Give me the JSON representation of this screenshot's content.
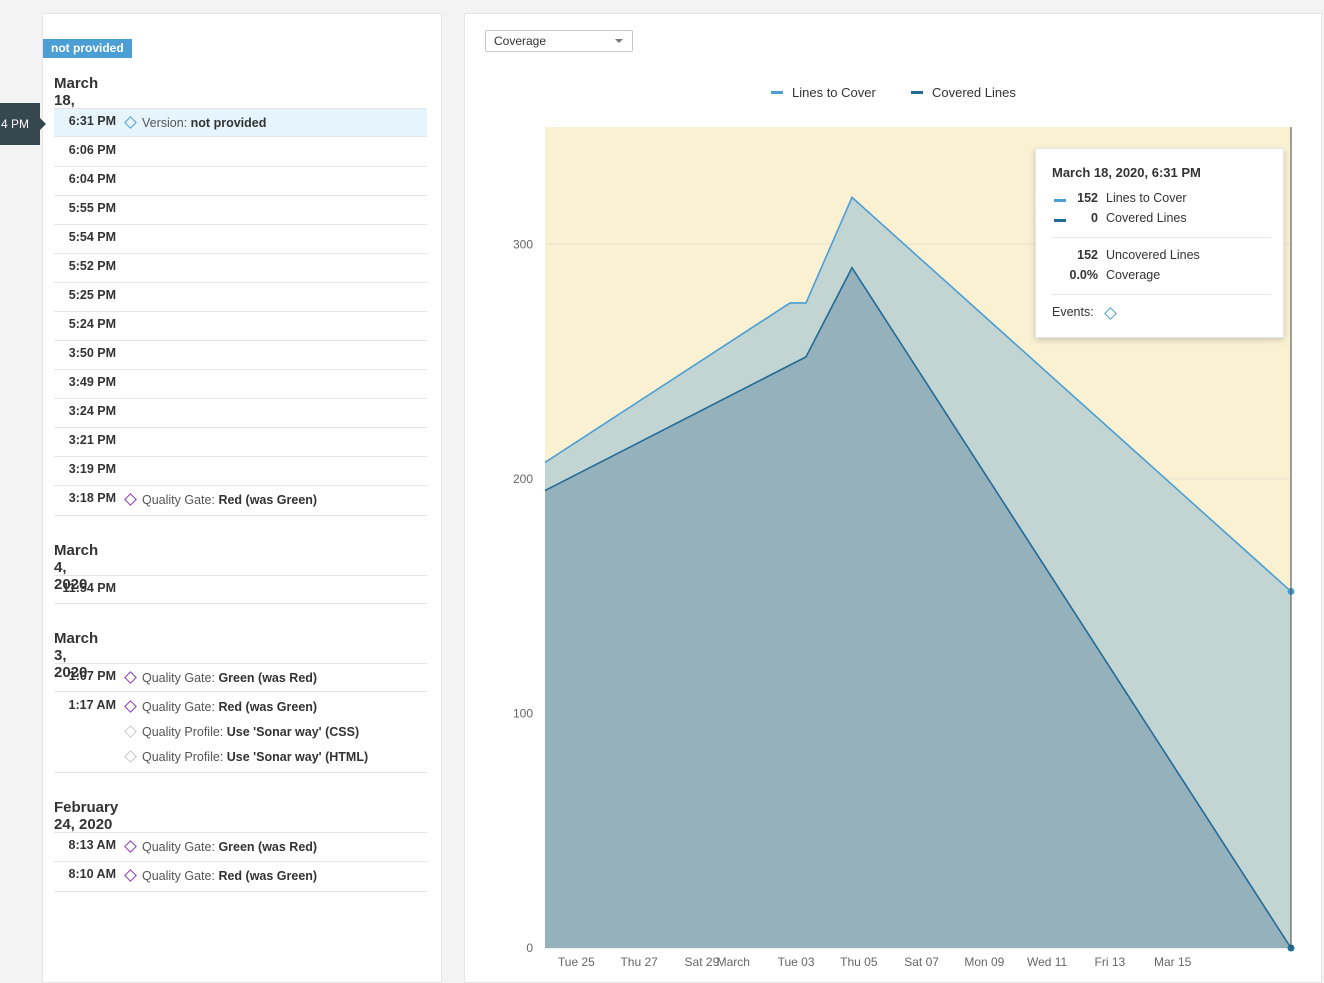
{
  "history": {
    "version_badge": "not provided",
    "pointer_label": "4 PM",
    "groups": [
      {
        "date": "March 18, 2020",
        "events": [
          {
            "time": "6:31 PM",
            "selected": true,
            "items": [
              {
                "kind": "version",
                "label": "Version:",
                "value": "not provided"
              }
            ]
          },
          {
            "time": "6:06 PM",
            "items": []
          },
          {
            "time": "6:04 PM",
            "items": []
          },
          {
            "time": "5:55 PM",
            "items": []
          },
          {
            "time": "5:54 PM",
            "items": []
          },
          {
            "time": "5:52 PM",
            "items": []
          },
          {
            "time": "5:25 PM",
            "items": []
          },
          {
            "time": "5:24 PM",
            "items": []
          },
          {
            "time": "3:50 PM",
            "items": []
          },
          {
            "time": "3:49 PM",
            "items": []
          },
          {
            "time": "3:24 PM",
            "items": []
          },
          {
            "time": "3:21 PM",
            "items": []
          },
          {
            "time": "3:19 PM",
            "items": []
          },
          {
            "time": "3:18 PM",
            "items": [
              {
                "kind": "gate",
                "label": "Quality Gate:",
                "value": "Red (was Green)"
              }
            ]
          }
        ]
      },
      {
        "date": "March 4, 2020",
        "events": [
          {
            "time": "11:54 PM",
            "items": []
          }
        ]
      },
      {
        "date": "March 3, 2020",
        "events": [
          {
            "time": "1:07 PM",
            "items": [
              {
                "kind": "gate",
                "label": "Quality Gate:",
                "value": "Green (was Red)"
              }
            ]
          },
          {
            "time": "1:17 AM",
            "items": [
              {
                "kind": "gate",
                "label": "Quality Gate:",
                "value": "Red (was Green)"
              },
              {
                "kind": "profile",
                "label": "Quality Profile:",
                "value": "Use 'Sonar way' (CSS)"
              },
              {
                "kind": "profile",
                "label": "Quality Profile:",
                "value": "Use 'Sonar way' (HTML)"
              }
            ]
          }
        ]
      },
      {
        "date": "February 24, 2020",
        "events": [
          {
            "time": "8:13 AM",
            "items": [
              {
                "kind": "gate",
                "label": "Quality Gate:",
                "value": "Green (was Red)"
              }
            ]
          },
          {
            "time": "8:10 AM",
            "items": [
              {
                "kind": "gate",
                "label": "Quality Gate:",
                "value": "Red (was Green)"
              }
            ]
          }
        ]
      }
    ]
  },
  "graph": {
    "metric_select": "Coverage",
    "legend": [
      {
        "name": "Lines to Cover",
        "color": "#4b9fd5"
      },
      {
        "name": "Covered Lines",
        "color": "#236a97"
      }
    ],
    "tooltip": {
      "title": "March 18, 2020, 6:31 PM",
      "series": [
        {
          "value": "152",
          "label": "Lines to Cover",
          "color": "#4b9fd5"
        },
        {
          "value": "0",
          "label": "Covered Lines",
          "color": "#236a97"
        }
      ],
      "uncovered_value": "152",
      "uncovered_label": "Uncovered Lines",
      "coverage_value": "0.0%",
      "coverage_label": "Coverage",
      "events_label": "Events:"
    }
  },
  "chart_data": {
    "type": "area",
    "x_ticks": [
      "Tue 25",
      "Thu 27",
      "Sat 29",
      "March",
      "Tue 03",
      "Thu 05",
      "Sat 07",
      "Mon 09",
      "Wed 11",
      "Fri 13",
      "Mar 15"
    ],
    "x_tick_dates": [
      "2020-02-25",
      "2020-02-27",
      "2020-02-29",
      "2020-03-01",
      "2020-03-03",
      "2020-03-05",
      "2020-03-07",
      "2020-03-09",
      "2020-03-11",
      "2020-03-13",
      "2020-03-15"
    ],
    "x_range": [
      "2020-02-24",
      "2020-03-18"
    ],
    "ylim": [
      0,
      350
    ],
    "y_ticks": [
      0,
      100,
      200,
      300
    ],
    "grid": true,
    "new_code_period_start": "2020-02-24",
    "series": [
      {
        "name": "Lines to Cover",
        "color": "#4b9fd5",
        "fill": "#c3d5d3",
        "points": [
          {
            "x": "2020-02-24",
            "y": 207
          },
          {
            "x": "2020-03-03",
            "y": 275
          },
          {
            "x": "2020-03-03",
            "y": 275
          },
          {
            "x": "2020-03-04",
            "y": 320
          },
          {
            "x": "2020-03-18",
            "y": 152
          }
        ]
      },
      {
        "name": "Covered Lines",
        "color": "#236a97",
        "fill": "#95b1bb",
        "points": [
          {
            "x": "2020-02-24",
            "y": 195
          },
          {
            "x": "2020-03-03",
            "y": 252
          },
          {
            "x": "2020-03-04",
            "y": 290
          },
          {
            "x": "2020-03-18",
            "y": 0
          }
        ]
      }
    ],
    "background": "#faf1d3"
  }
}
